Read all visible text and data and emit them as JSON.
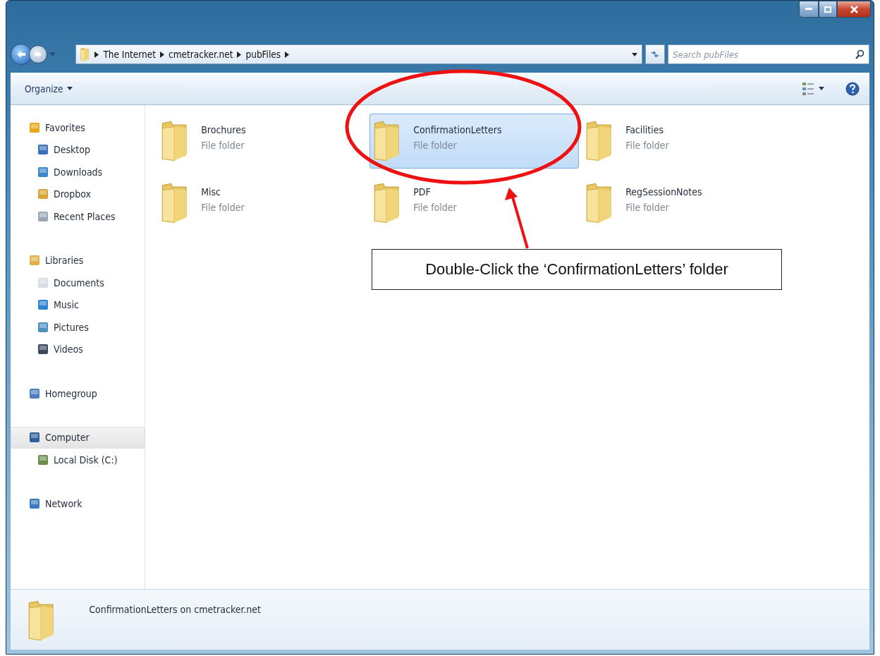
{
  "address_bar": {
    "crumbs": [
      "The Internet",
      "cmetracker.net",
      "pubFiles"
    ]
  },
  "search": {
    "placeholder": "Search pubFiles"
  },
  "toolbar": {
    "organize": "Organize"
  },
  "navigation": [
    {
      "label": "Favorites",
      "selected": false,
      "children": [
        {
          "label": "Desktop",
          "selected": false
        },
        {
          "label": "Downloads",
          "selected": false
        },
        {
          "label": "Dropbox",
          "selected": false
        },
        {
          "label": "Recent Places",
          "selected": false
        }
      ]
    },
    {
      "label": "Libraries",
      "selected": false,
      "children": [
        {
          "label": "Documents",
          "selected": false
        },
        {
          "label": "Music",
          "selected": false
        },
        {
          "label": "Pictures",
          "selected": false
        },
        {
          "label": "Videos",
          "selected": false
        }
      ]
    },
    {
      "label": "Homegroup",
      "selected": false
    },
    {
      "label": "Computer",
      "selected": true,
      "children": [
        {
          "label": "Local Disk (C:)",
          "selected": false
        }
      ]
    },
    {
      "label": "Network",
      "selected": false
    }
  ],
  "folders": [
    {
      "name": "Brochures",
      "type": "File folder",
      "selected": false
    },
    {
      "name": "ConfirmationLetters",
      "type": "File folder",
      "selected": true
    },
    {
      "name": "Facilities",
      "type": "File folder",
      "selected": false
    },
    {
      "name": "Misc",
      "type": "File folder",
      "selected": false
    },
    {
      "name": "PDF",
      "type": "File folder",
      "selected": false
    },
    {
      "name": "RegSessionNotes",
      "type": "File folder",
      "selected": false
    }
  ],
  "details_pane": {
    "text": "ConfirmationLetters on cmetracker.net"
  },
  "annotation": {
    "callout": "Double-Click the ‘ConfirmationLetters’ folder"
  }
}
